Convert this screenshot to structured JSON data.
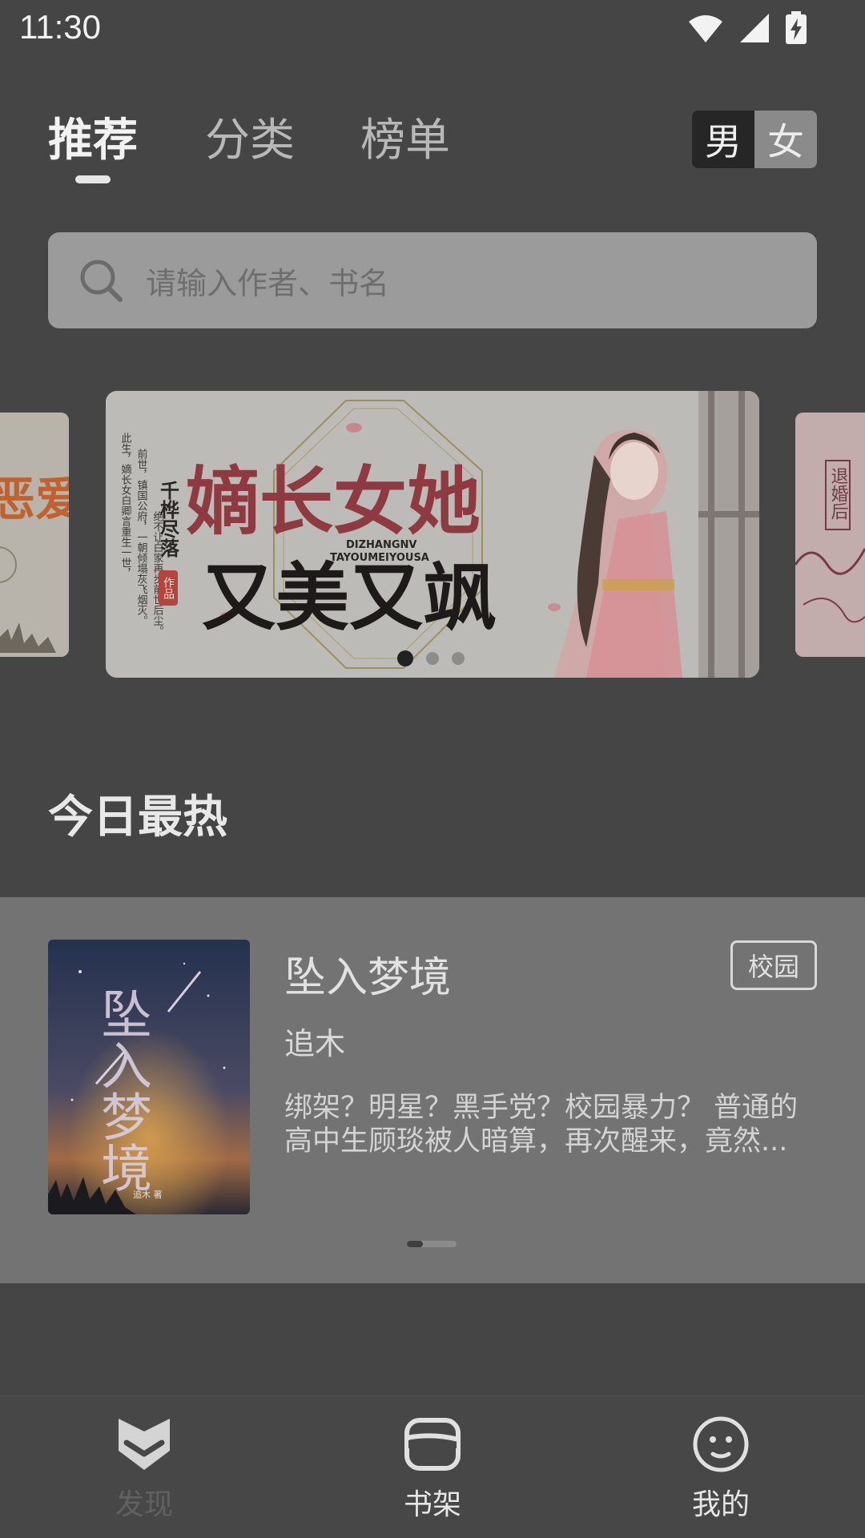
{
  "status_bar": {
    "time": "11:30",
    "icons": [
      "wifi-icon",
      "signal-icon",
      "battery-charging-icon"
    ]
  },
  "top_tabs": [
    {
      "label": "推荐",
      "active": true
    },
    {
      "label": "分类",
      "active": false
    },
    {
      "label": "榜单",
      "active": false
    }
  ],
  "gender_switch": {
    "male": "男",
    "female": "女",
    "selected": "男"
  },
  "search": {
    "placeholder": "请输入作者、书名",
    "icon": "search-icon"
  },
  "carousel": {
    "left_peek_text": "恶爱",
    "right_peek_text": "退婚后",
    "banner": {
      "title_line1": "嫡长女她",
      "title_line2": "又美又飒",
      "pinyin_line1": "DIZHANGNV",
      "pinyin_line2": "TAYOUMEIYOUSA",
      "author": "千桦尽落",
      "author_stamp": "作品",
      "blurb_col1": "此生，嫡长女白卿言重生一世，",
      "blurb_col2": "前世，镇国公府，一朝倾塌灰飞烟灭。",
      "blurb_col3": "绝不让白家再步前世后尘。"
    },
    "page_count": 3,
    "current_page": 1
  },
  "section": {
    "title": "今日最热"
  },
  "hot_book": {
    "title": "坠入梦境",
    "tag": "校园",
    "author": "追木",
    "description": "绑架？明星？黑手党？校园暴力？ 普通的高中生顾琰被人暗算，再次醒来，竟然...",
    "cover_title": "坠入梦境",
    "cover_author": "追木 著"
  },
  "bottom_nav": [
    {
      "label": "发现",
      "icon": "discover-chevron-icon",
      "active": true
    },
    {
      "label": "书架",
      "icon": "bookshelf-icon",
      "active": false
    },
    {
      "label": "我的",
      "icon": "smiley-face-icon",
      "active": false
    }
  ],
  "colors": {
    "background": "#454545",
    "panel": "#737373",
    "active_nav": "#d9d9d9"
  }
}
